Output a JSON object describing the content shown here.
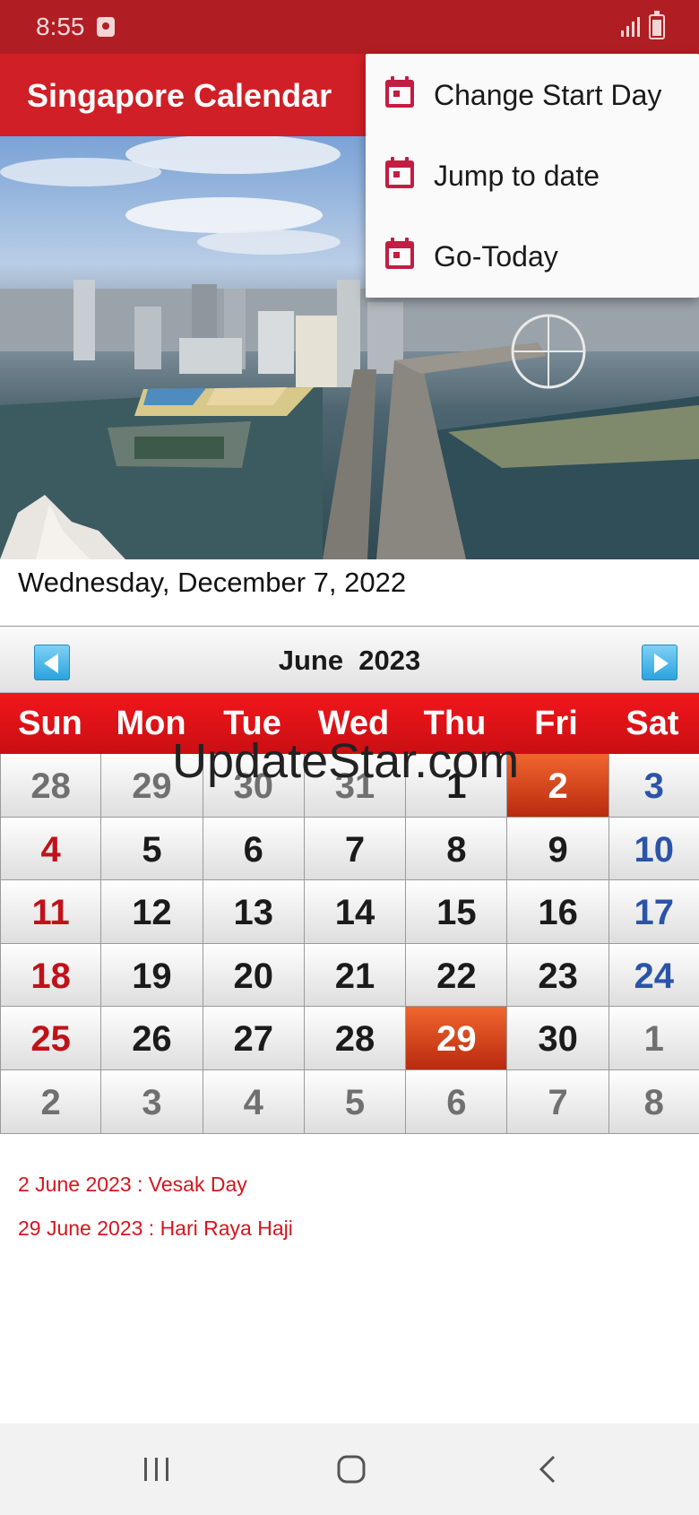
{
  "status_bar": {
    "time": "8:55",
    "icons": [
      "notification-icon",
      "signal-icon",
      "battery-charging-icon"
    ]
  },
  "app_bar": {
    "title": "Singapore Calendar",
    "color": "#d01f26"
  },
  "menu": {
    "items": [
      {
        "label": "Change Start Day",
        "icon": "calendar-icon"
      },
      {
        "label": "Jump to date",
        "icon": "calendar-icon"
      },
      {
        "label": "Go-Today",
        "icon": "calendar-icon"
      }
    ]
  },
  "current_date": "Wednesday, December 7, 2022",
  "calendar": {
    "month_label": "June  2023",
    "weekdays": [
      "Sun",
      "Mon",
      "Tue",
      "Wed",
      "Thu",
      "Fri",
      "Sat"
    ],
    "weeks": [
      [
        "28",
        "29",
        "30",
        "31",
        "1",
        "2",
        "3"
      ],
      [
        "4",
        "5",
        "6",
        "7",
        "8",
        "9",
        "10"
      ],
      [
        "11",
        "12",
        "13",
        "14",
        "15",
        "16",
        "17"
      ],
      [
        "18",
        "19",
        "20",
        "21",
        "22",
        "23",
        "24"
      ],
      [
        "25",
        "26",
        "27",
        "28",
        "29",
        "30",
        "1"
      ],
      [
        "2",
        "3",
        "4",
        "5",
        "6",
        "7",
        "8"
      ]
    ],
    "holiday_color": "#c9381a",
    "weekday_bar_color": "#e3141a"
  },
  "watermark": "UpdateStar.com",
  "holidays": [
    "2 June 2023 : Vesak Day",
    "29 June 2023 : Hari Raya Haji"
  ],
  "nav_bar": {
    "buttons": [
      "recent-apps-icon",
      "home-icon",
      "back-icon"
    ]
  }
}
